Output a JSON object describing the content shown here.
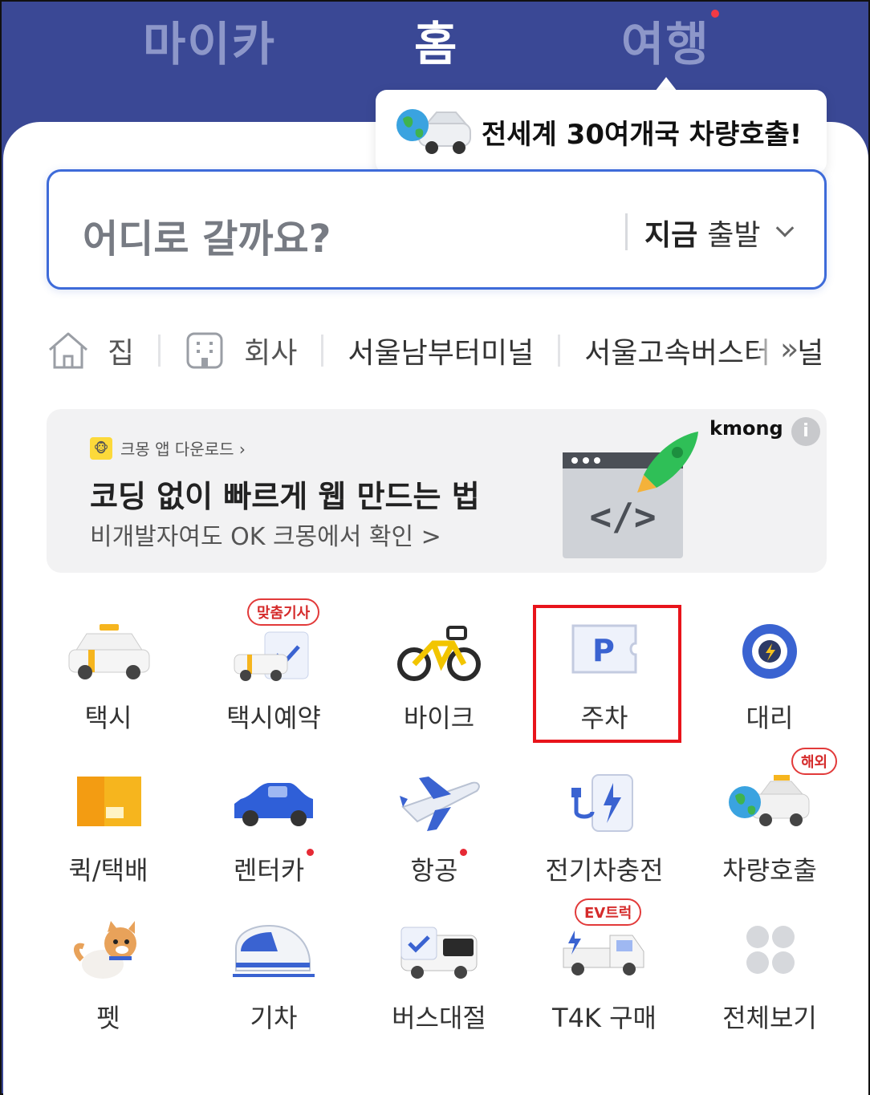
{
  "tabs": [
    {
      "label": "마이카",
      "active": false
    },
    {
      "label": "홈",
      "active": true
    },
    {
      "label": "여행",
      "active": false,
      "dot": true
    }
  ],
  "tooltip": {
    "text": "전세계 30여개국 차량호출!"
  },
  "search": {
    "placeholder": "어디로 갈까요?",
    "depart_bold": "지금",
    "depart_rest": "출발"
  },
  "quick_places": [
    {
      "label": "집",
      "icon": "home-icon"
    },
    {
      "label": "회사",
      "icon": "building-icon"
    },
    {
      "label": "서울남부터미널"
    },
    {
      "label": "서울고속버스터미널"
    }
  ],
  "quick_more": "»",
  "banner": {
    "app": "크몽 앱 다운로드 ›",
    "title": "코딩 없이 빠르게 웹 만드는 법",
    "subtitle": "비개발자여도 OK 크몽에서 확인 >",
    "brand": "kmong",
    "info": "i"
  },
  "services": [
    {
      "label": "택시",
      "icon": "taxi-icon"
    },
    {
      "label": "택시예약",
      "icon": "taxi-reserve-icon",
      "badge": "맞춤기사"
    },
    {
      "label": "바이크",
      "icon": "bike-icon"
    },
    {
      "label": "주차",
      "icon": "parking-icon",
      "highlighted": true
    },
    {
      "label": "대리",
      "icon": "steering-wheel-icon"
    },
    {
      "label": "퀵/택배",
      "icon": "box-icon"
    },
    {
      "label": "렌터카",
      "icon": "rental-car-icon",
      "dot": true
    },
    {
      "label": "항공",
      "icon": "airplane-icon",
      "dot": true
    },
    {
      "label": "전기차충전",
      "icon": "ev-charger-icon"
    },
    {
      "label": "차량호출",
      "icon": "global-car-icon",
      "badge": "해외"
    },
    {
      "label": "펫",
      "icon": "pet-dog-icon"
    },
    {
      "label": "기차",
      "icon": "train-icon"
    },
    {
      "label": "버스대절",
      "icon": "bus-icon"
    },
    {
      "label": "T4K 구매",
      "icon": "ev-truck-icon",
      "badge": "EV트럭"
    },
    {
      "label": "전체보기",
      "icon": "all-grid-icon"
    }
  ],
  "colors": {
    "header": "#3a4895",
    "accent": "#3e6bd9",
    "highlight": "#e8141b"
  }
}
